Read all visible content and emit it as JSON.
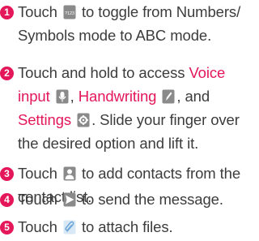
{
  "steps": [
    {
      "number": "1",
      "line1": {
        "a": "Touch",
        "b": "to toggle from Numbers/"
      },
      "line2": "Symbols mode to ABC mode.",
      "icon": "numbers-symbols-key-icon",
      "icon_text": "?123"
    },
    {
      "number": "2",
      "line1_a": "Touch and hold to access",
      "voice": "Voice",
      "line2_voice_input": "input",
      "line2_sep": ",",
      "handwriting": "Handwriting",
      "line2_and": ", and",
      "settings": "Settings",
      "line3_rest": ". Slide your finger over",
      "line4": "the desired option and lift it.",
      "icons": [
        "voice-input-icon",
        "handwriting-icon",
        "settings-icon"
      ]
    },
    {
      "number": "3",
      "line1": {
        "a": "Touch",
        "b": "to add contacts from the"
      },
      "line2": "contact list.",
      "icon": "contacts-icon"
    },
    {
      "number": "4",
      "line1": {
        "a": "Touch",
        "b": "to send the message."
      },
      "icon": "send-icon"
    },
    {
      "number": "5",
      "line1": {
        "a": "Touch",
        "b": "to attach files."
      },
      "icon": "attach-icon"
    }
  ],
  "colors": {
    "accent": "#e3175a",
    "text": "#3c3c3c",
    "icon_gray": "#8a8a8a",
    "icon_blue": "#6fa8d8"
  }
}
